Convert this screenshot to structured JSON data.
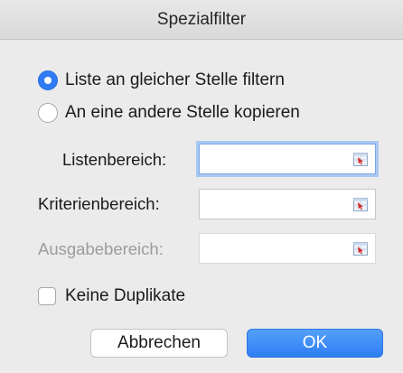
{
  "dialog": {
    "title": "Spezialfilter",
    "action_options": [
      {
        "label": "Liste an gleicher Stelle filtern",
        "selected": true
      },
      {
        "label": "An eine andere Stelle kopieren",
        "selected": false
      }
    ],
    "fields": {
      "list_range": {
        "label": "Listenbereich:",
        "value": "",
        "enabled": true,
        "focused": true
      },
      "criteria_range": {
        "label": "Kriterienbereich:",
        "value": "",
        "enabled": true
      },
      "output_range": {
        "label": "Ausgabebereich:",
        "value": "",
        "enabled": false
      }
    },
    "unique_records": {
      "label": "Keine Duplikate",
      "checked": false
    },
    "buttons": {
      "cancel": "Abbrechen",
      "ok": "OK"
    },
    "colors": {
      "accent": "#2f7cf6",
      "focus_ring": "#a9c8f2",
      "disabled_text": "#9c9c9c"
    },
    "icons": {
      "range_picker": "range-selector-icon"
    }
  }
}
